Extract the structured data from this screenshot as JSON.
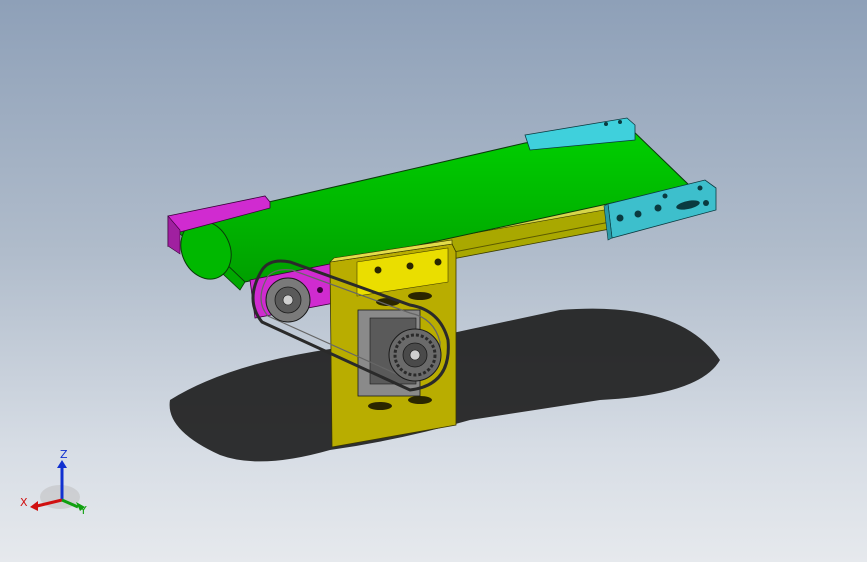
{
  "viewport": {
    "type": "3d-cad-view",
    "background_top": "#8ea0b8",
    "background_bottom": "#e6e9ed"
  },
  "model": {
    "parts": [
      {
        "name": "conveyor-belt",
        "color": "#00b400"
      },
      {
        "name": "left-end-bracket",
        "color": "#d02bd0"
      },
      {
        "name": "right-end-bracket",
        "color": "#35c6d2"
      },
      {
        "name": "side-frame-rail",
        "color": "#b8b400"
      },
      {
        "name": "motor-mount-plate",
        "color": "#bdb000"
      },
      {
        "name": "drive-belt",
        "color": "#3a3a3a"
      },
      {
        "name": "driven-pulley",
        "color": "#6a6a6a"
      },
      {
        "name": "drive-pulley",
        "color": "#5a5a5a"
      },
      {
        "name": "motor",
        "color": "#9a9a9a"
      }
    ]
  },
  "triad": {
    "x_label": "X",
    "y_label": "Y",
    "z_label": "Z",
    "x_color": "#d01010",
    "y_color": "#10a010",
    "z_color": "#1030d0"
  }
}
